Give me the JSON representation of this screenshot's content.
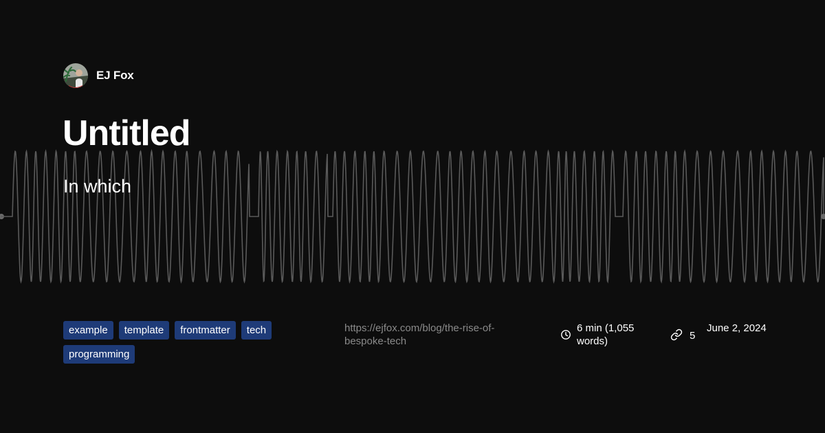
{
  "author": {
    "name": "EJ Fox"
  },
  "post": {
    "title": "Untitled",
    "subtitle": "In which",
    "url": "https://ejfox.com/blog/the-rise-of-bespoke-tech",
    "tags": [
      "example",
      "template",
      "frontmatter",
      "tech",
      "programming"
    ],
    "reading_time": "6 min (1,055 words)",
    "link_count": "5",
    "date": "June 2, 2024"
  },
  "icons": {
    "reading_time": "clock-icon",
    "links": "link-icon"
  },
  "colors": {
    "background": "#0d0d0d",
    "tag_background": "#1e3b78",
    "waveform": "#5a5a5a",
    "url_text": "#8a8a8a",
    "text": "#ffffff"
  }
}
